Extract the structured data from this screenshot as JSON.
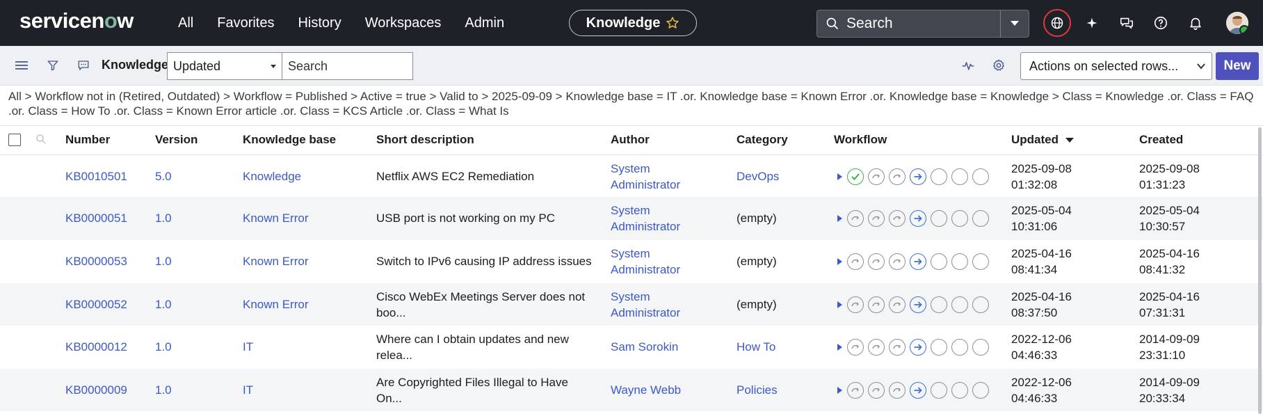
{
  "nav": {
    "logo": "servicenow",
    "links": [
      "All",
      "Favorites",
      "History",
      "Workspaces",
      "Admin"
    ],
    "app_pill": "Knowledge",
    "search_placeholder": "Search"
  },
  "toolbar": {
    "title": "Knowledge",
    "sort_select": "Updated",
    "search_placeholder": "Search",
    "actions_select": "Actions on selected rows...",
    "new_button": "New"
  },
  "breadcrumb": "All > Workflow not in (Retired, Outdated) > Workflow = Published > Active = true > Valid to > 2025-09-09 > Knowledge base = IT .or. Knowledge base = Known Error .or. Knowledge base = Knowledge > Class = Knowledge .or. Class = FAQ .or. Class = How To .or. Class = Known Error article .or. Class = KCS Article .or. Class = What Is",
  "table": {
    "headers": [
      "Number",
      "Version",
      "Knowledge base",
      "Short description",
      "Author",
      "Category",
      "Workflow",
      "Updated",
      "Created"
    ],
    "rows": [
      {
        "number": "KB0010501",
        "version": "5.0",
        "kb": "Knowledge",
        "desc1": "Netflix AWS EC2 Remediation",
        "desc2": "",
        "author1": "System",
        "author2": "Administrator",
        "category": "DevOps",
        "category_link": true,
        "first_done": true,
        "upd1": "2025-09-08",
        "upd2": "01:32:08",
        "cre1": "2025-09-08",
        "cre2": "01:31:23"
      },
      {
        "number": "KB0000051",
        "version": "1.0",
        "kb": "Known Error",
        "desc1": "USB port is not working on my PC",
        "desc2": "",
        "author1": "System",
        "author2": "Administrator",
        "category": "(empty)",
        "category_link": false,
        "first_done": false,
        "upd1": "2025-05-04",
        "upd2": "10:31:06",
        "cre1": "2025-05-04",
        "cre2": "10:30:57"
      },
      {
        "number": "KB0000053",
        "version": "1.0",
        "kb": "Known Error",
        "desc1": "Switch to IPv6 causing IP address issues",
        "desc2": "",
        "author1": "System",
        "author2": "Administrator",
        "category": "(empty)",
        "category_link": false,
        "first_done": false,
        "upd1": "2025-04-16",
        "upd2": "08:41:34",
        "cre1": "2025-04-16",
        "cre2": "08:41:32"
      },
      {
        "number": "KB0000052",
        "version": "1.0",
        "kb": "Known Error",
        "desc1": "Cisco WebEx Meetings Server does not",
        "desc2": "boo...",
        "author1": "System",
        "author2": "Administrator",
        "category": "(empty)",
        "category_link": false,
        "first_done": false,
        "upd1": "2025-04-16",
        "upd2": "08:37:50",
        "cre1": "2025-04-16",
        "cre2": "07:31:31"
      },
      {
        "number": "KB0000012",
        "version": "1.0",
        "kb": "IT",
        "desc1": "Where can I obtain updates and new",
        "desc2": "relea...",
        "author1": "Sam Sorokin",
        "author2": "",
        "category": "How To",
        "category_link": true,
        "first_done": false,
        "upd1": "2022-12-06",
        "upd2": "04:46:33",
        "cre1": "2014-09-09",
        "cre2": "23:31:10"
      },
      {
        "number": "KB0000009",
        "version": "1.0",
        "kb": "IT",
        "desc1": "Are Copyrighted Files Illegal to Have",
        "desc2": "On...",
        "author1": "Wayne Webb",
        "author2": "",
        "category": "Policies",
        "category_link": true,
        "first_done": false,
        "upd1": "2022-12-06",
        "upd2": "04:46:33",
        "cre1": "2014-09-09",
        "cre2": "20:33:34"
      }
    ]
  }
}
